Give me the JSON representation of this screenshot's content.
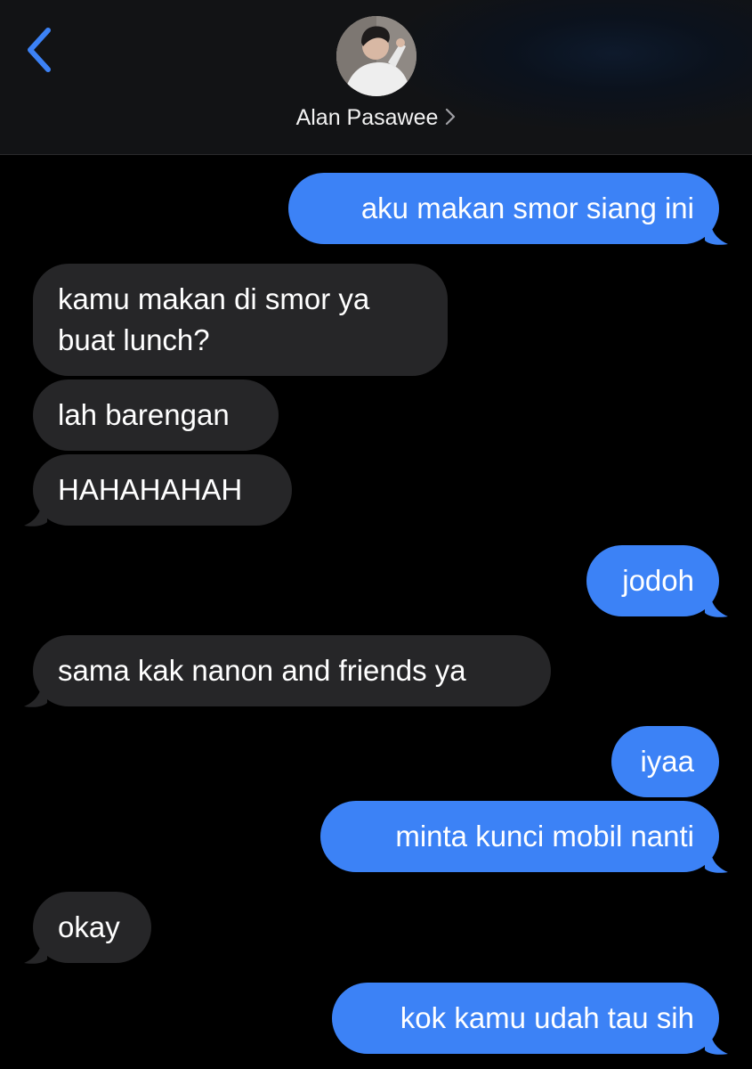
{
  "header": {
    "contact_name": "Alan Pasawee",
    "icons": {
      "back": "chevron-left-icon",
      "details": "chevron-right-icon",
      "avatar": "contact-avatar"
    }
  },
  "colors": {
    "outgoing_bubble": "#3c82f6",
    "incoming_bubble": "#262628",
    "accent": "#3c82f6",
    "background": "#000000"
  },
  "messages": [
    {
      "direction": "outgoing",
      "text": "aku makan smor siang ini"
    },
    {
      "direction": "incoming",
      "text_line1": "kamu makan di smor ya",
      "text_line2": "buat lunch?"
    },
    {
      "direction": "incoming",
      "text": "lah barengan"
    },
    {
      "direction": "incoming",
      "text": "HAHAHAHAH"
    },
    {
      "direction": "outgoing",
      "text": "jodoh"
    },
    {
      "direction": "incoming",
      "text": "sama kak nanon and friends ya"
    },
    {
      "direction": "outgoing",
      "text": "iyaa"
    },
    {
      "direction": "outgoing",
      "text": "minta kunci mobil nanti"
    },
    {
      "direction": "incoming",
      "text": "okay"
    },
    {
      "direction": "outgoing",
      "text": "kok kamu udah tau sih"
    }
  ]
}
